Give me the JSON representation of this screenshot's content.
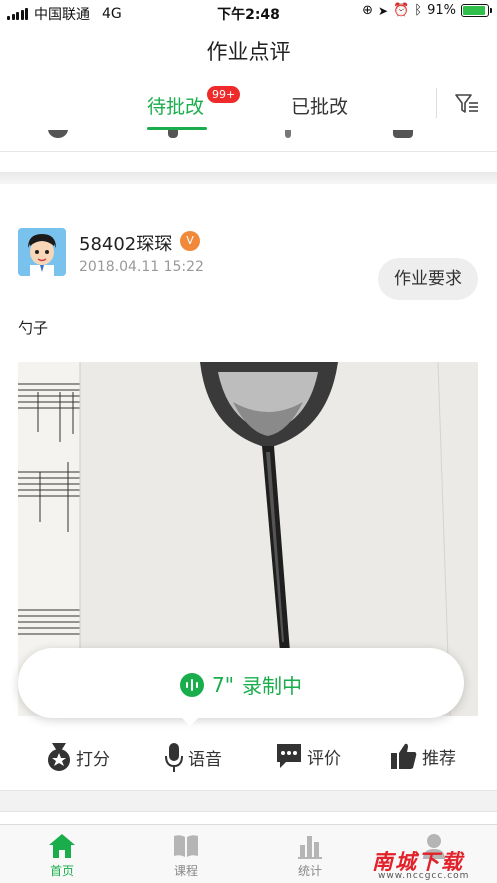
{
  "status_bar": {
    "carrier": "中国联通",
    "network": "4G",
    "time": "下午2:48",
    "battery": "91%",
    "battery_level": 0.91
  },
  "nav": {
    "title": "作业点评"
  },
  "tabs": [
    {
      "label": "待批改",
      "badge": "99+",
      "active": true
    },
    {
      "label": "已批改",
      "active": false
    }
  ],
  "filter_icon": "filter-list-icon",
  "card": {
    "username": "58402琛琛",
    "vip_badge": "V",
    "date": "2018.04.11 15:22",
    "requirement_button": "作业要求",
    "description": "勺子",
    "recording": {
      "duration": "7\"",
      "status": "录制中"
    }
  },
  "actions": [
    {
      "label": "打分",
      "icon": "medal-icon"
    },
    {
      "label": "语音",
      "icon": "microphone-icon"
    },
    {
      "label": "评价",
      "icon": "comment-icon"
    },
    {
      "label": "推荐",
      "icon": "thumbs-up-icon"
    }
  ],
  "tabbar": [
    {
      "label": "首页",
      "icon": "home-icon",
      "active": true
    },
    {
      "label": "课程",
      "icon": "book-icon",
      "active": false
    },
    {
      "label": "统计",
      "icon": "bar-chart-icon",
      "active": false
    },
    {
      "label": "",
      "icon": "person-icon",
      "active": false
    }
  ],
  "watermark": {
    "title": "南城下载",
    "sub": "www.nccgcc.com"
  },
  "colors": {
    "accent": "#1aad4b",
    "badge": "#ee2a2a",
    "vip": "#f08a3a"
  }
}
